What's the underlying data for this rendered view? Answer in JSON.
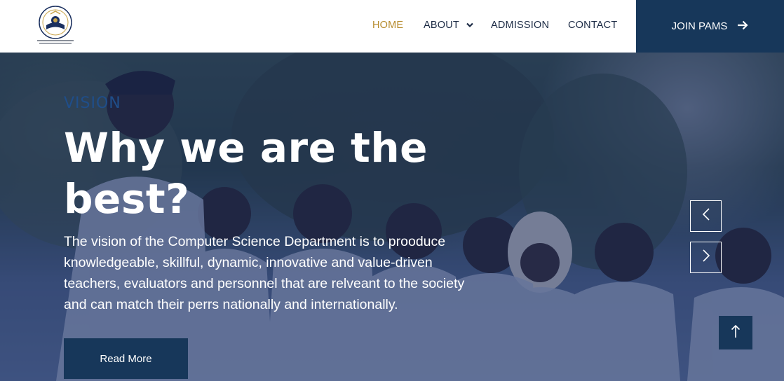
{
  "nav": {
    "items": [
      {
        "label": "HOME",
        "active": true
      },
      {
        "label": "ABOUT",
        "has_dropdown": true
      },
      {
        "label": "ADMISSION"
      },
      {
        "label": "CONTACT"
      }
    ],
    "cta_label": "JOIN PAMS"
  },
  "hero": {
    "eyebrow": "VISION",
    "title": "Why we are the best?",
    "description": "The vision of the Computer Science Department is to prooduce knowledgeable, skillful, dynamic, innovative and value-driven teachers, evaluators and personnel that are relveant to the society and can match their perrs nationally and internationally.",
    "button_label": "Read More"
  },
  "colors": {
    "accent_nav_active": "#b58a2b",
    "primary_dark": "#17375a",
    "nav_text": "#1b2a44"
  },
  "icons": {
    "logo": "school-crest-logo",
    "cta": "arrow-right-icon",
    "prev": "chevron-left-icon",
    "next": "chevron-right-icon",
    "scroll_top": "arrow-up-icon",
    "dropdown": "chevron-down-icon"
  }
}
